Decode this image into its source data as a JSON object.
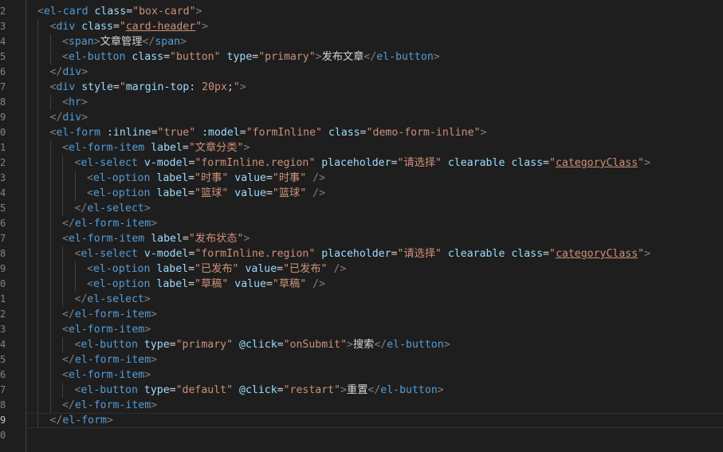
{
  "editor": {
    "language": "vue-html",
    "theme_colors": {
      "background": "#1e1e1e",
      "bracket": "#808080",
      "tag": "#569cd6",
      "attribute": "#9cdcfe",
      "string": "#ce9178",
      "text": "#d4d4d4",
      "line_number": "#858585"
    },
    "active_line_number": "9",
    "line_numbers": [
      "2",
      "3",
      "4",
      "5",
      "6",
      "7",
      "8",
      "9",
      "0",
      "1",
      "2",
      "3",
      "4",
      "5",
      "6",
      "7",
      "8",
      "9",
      "0",
      "1",
      "2",
      "3",
      "4",
      "5",
      "6",
      "7",
      "8",
      "9",
      "0"
    ],
    "lines": [
      {
        "indent": 0,
        "tokens": [
          [
            "brk",
            "<"
          ],
          [
            "tag",
            "el-card"
          ],
          [
            "txt",
            " "
          ],
          [
            "attr",
            "class"
          ],
          [
            "eq",
            "="
          ],
          [
            "str",
            "\"box-card\""
          ],
          [
            "brk",
            ">"
          ]
        ]
      },
      {
        "indent": 1,
        "tokens": [
          [
            "brk",
            "<"
          ],
          [
            "tag",
            "div"
          ],
          [
            "txt",
            " "
          ],
          [
            "attr",
            "class"
          ],
          [
            "eq",
            "="
          ],
          [
            "str",
            "\""
          ],
          [
            "strul",
            "card-header"
          ],
          [
            "str",
            "\""
          ],
          [
            "brk",
            ">"
          ]
        ]
      },
      {
        "indent": 2,
        "tokens": [
          [
            "brk",
            "<"
          ],
          [
            "tag",
            "span"
          ],
          [
            "brk",
            ">"
          ],
          [
            "txt",
            "文章管理"
          ],
          [
            "brk",
            "</"
          ],
          [
            "tag",
            "span"
          ],
          [
            "brk",
            ">"
          ]
        ]
      },
      {
        "indent": 2,
        "tokens": [
          [
            "brk",
            "<"
          ],
          [
            "tag",
            "el-button"
          ],
          [
            "txt",
            " "
          ],
          [
            "attr",
            "class"
          ],
          [
            "eq",
            "="
          ],
          [
            "str",
            "\"button\""
          ],
          [
            "txt",
            " "
          ],
          [
            "attr",
            "type"
          ],
          [
            "eq",
            "="
          ],
          [
            "str",
            "\"primary\""
          ],
          [
            "brk",
            ">"
          ],
          [
            "txt",
            "发布文章"
          ],
          [
            "brk",
            "</"
          ],
          [
            "tag",
            "el-button"
          ],
          [
            "brk",
            ">"
          ]
        ]
      },
      {
        "indent": 1,
        "tokens": [
          [
            "brk",
            "</"
          ],
          [
            "tag",
            "div"
          ],
          [
            "brk",
            ">"
          ]
        ]
      },
      {
        "indent": 1,
        "tokens": [
          [
            "brk",
            "<"
          ],
          [
            "tag",
            "div"
          ],
          [
            "txt",
            " "
          ],
          [
            "attr",
            "style"
          ],
          [
            "eq",
            "="
          ],
          [
            "str",
            "\""
          ],
          [
            "attr",
            "margin-top"
          ],
          [
            "txt",
            ": "
          ],
          [
            "str",
            "20px"
          ],
          [
            "txt",
            ";"
          ],
          [
            "str",
            "\""
          ],
          [
            "brk",
            ">"
          ]
        ]
      },
      {
        "indent": 2,
        "tokens": [
          [
            "brk",
            "<"
          ],
          [
            "tag",
            "hr"
          ],
          [
            "brk",
            ">"
          ]
        ]
      },
      {
        "indent": 1,
        "tokens": [
          [
            "brk",
            "</"
          ],
          [
            "tag",
            "div"
          ],
          [
            "brk",
            ">"
          ]
        ]
      },
      {
        "indent": 1,
        "tokens": [
          [
            "brk",
            "<"
          ],
          [
            "tag",
            "el-form"
          ],
          [
            "txt",
            " "
          ],
          [
            "attr",
            ":inline"
          ],
          [
            "eq",
            "="
          ],
          [
            "str",
            "\"true\""
          ],
          [
            "txt",
            " "
          ],
          [
            "attr",
            ":model"
          ],
          [
            "eq",
            "="
          ],
          [
            "str",
            "\"formInline\""
          ],
          [
            "txt",
            " "
          ],
          [
            "attr",
            "class"
          ],
          [
            "eq",
            "="
          ],
          [
            "str",
            "\"demo-form-inline\""
          ],
          [
            "brk",
            ">"
          ]
        ]
      },
      {
        "indent": 2,
        "tokens": [
          [
            "brk",
            "<"
          ],
          [
            "tag",
            "el-form-item"
          ],
          [
            "txt",
            " "
          ],
          [
            "attr",
            "label"
          ],
          [
            "eq",
            "="
          ],
          [
            "str",
            "\"文章分类\""
          ],
          [
            "brk",
            ">"
          ]
        ]
      },
      {
        "indent": 3,
        "tokens": [
          [
            "brk",
            "<"
          ],
          [
            "tag",
            "el-select"
          ],
          [
            "txt",
            " "
          ],
          [
            "attr",
            "v-model"
          ],
          [
            "eq",
            "="
          ],
          [
            "str",
            "\"formInline.region\""
          ],
          [
            "txt",
            " "
          ],
          [
            "attr",
            "placeholder"
          ],
          [
            "eq",
            "="
          ],
          [
            "str",
            "\"请选择\""
          ],
          [
            "txt",
            " "
          ],
          [
            "attr",
            "clearable"
          ],
          [
            "txt",
            " "
          ],
          [
            "attr",
            "class"
          ],
          [
            "eq",
            "="
          ],
          [
            "str",
            "\""
          ],
          [
            "strul",
            "categoryClass"
          ],
          [
            "str",
            "\""
          ],
          [
            "brk",
            ">"
          ]
        ]
      },
      {
        "indent": 4,
        "tokens": [
          [
            "brk",
            "<"
          ],
          [
            "tag",
            "el-option"
          ],
          [
            "txt",
            " "
          ],
          [
            "attr",
            "label"
          ],
          [
            "eq",
            "="
          ],
          [
            "str",
            "\"时事\""
          ],
          [
            "txt",
            " "
          ],
          [
            "attr",
            "value"
          ],
          [
            "eq",
            "="
          ],
          [
            "str",
            "\"时事\""
          ],
          [
            "txt",
            " "
          ],
          [
            "brk",
            "/>"
          ]
        ]
      },
      {
        "indent": 4,
        "tokens": [
          [
            "brk",
            "<"
          ],
          [
            "tag",
            "el-option"
          ],
          [
            "txt",
            " "
          ],
          [
            "attr",
            "label"
          ],
          [
            "eq",
            "="
          ],
          [
            "str",
            "\"篮球\""
          ],
          [
            "txt",
            " "
          ],
          [
            "attr",
            "value"
          ],
          [
            "eq",
            "="
          ],
          [
            "str",
            "\"篮球\""
          ],
          [
            "txt",
            " "
          ],
          [
            "brk",
            "/>"
          ]
        ]
      },
      {
        "indent": 3,
        "tokens": [
          [
            "brk",
            "</"
          ],
          [
            "tag",
            "el-select"
          ],
          [
            "brk",
            ">"
          ]
        ]
      },
      {
        "indent": 2,
        "tokens": [
          [
            "brk",
            "</"
          ],
          [
            "tag",
            "el-form-item"
          ],
          [
            "brk",
            ">"
          ]
        ]
      },
      {
        "indent": 2,
        "tokens": [
          [
            "brk",
            "<"
          ],
          [
            "tag",
            "el-form-item"
          ],
          [
            "txt",
            " "
          ],
          [
            "attr",
            "label"
          ],
          [
            "eq",
            "="
          ],
          [
            "str",
            "\"发布状态\""
          ],
          [
            "brk",
            ">"
          ]
        ]
      },
      {
        "indent": 3,
        "tokens": [
          [
            "brk",
            "<"
          ],
          [
            "tag",
            "el-select"
          ],
          [
            "txt",
            " "
          ],
          [
            "attr",
            "v-model"
          ],
          [
            "eq",
            "="
          ],
          [
            "str",
            "\"formInline.region\""
          ],
          [
            "txt",
            " "
          ],
          [
            "attr",
            "placeholder"
          ],
          [
            "eq",
            "="
          ],
          [
            "str",
            "\"请选择\""
          ],
          [
            "txt",
            " "
          ],
          [
            "attr",
            "clearable"
          ],
          [
            "txt",
            " "
          ],
          [
            "attr",
            "class"
          ],
          [
            "eq",
            "="
          ],
          [
            "str",
            "\""
          ],
          [
            "strul",
            "categoryClass"
          ],
          [
            "str",
            "\""
          ],
          [
            "brk",
            ">"
          ]
        ]
      },
      {
        "indent": 4,
        "tokens": [
          [
            "brk",
            "<"
          ],
          [
            "tag",
            "el-option"
          ],
          [
            "txt",
            " "
          ],
          [
            "attr",
            "label"
          ],
          [
            "eq",
            "="
          ],
          [
            "str",
            "\"已发布\""
          ],
          [
            "txt",
            " "
          ],
          [
            "attr",
            "value"
          ],
          [
            "eq",
            "="
          ],
          [
            "str",
            "\"已发布\""
          ],
          [
            "txt",
            " "
          ],
          [
            "brk",
            "/>"
          ]
        ]
      },
      {
        "indent": 4,
        "tokens": [
          [
            "brk",
            "<"
          ],
          [
            "tag",
            "el-option"
          ],
          [
            "txt",
            " "
          ],
          [
            "attr",
            "label"
          ],
          [
            "eq",
            "="
          ],
          [
            "str",
            "\"草稿\""
          ],
          [
            "txt",
            " "
          ],
          [
            "attr",
            "value"
          ],
          [
            "eq",
            "="
          ],
          [
            "str",
            "\"草稿\""
          ],
          [
            "txt",
            " "
          ],
          [
            "brk",
            "/>"
          ]
        ]
      },
      {
        "indent": 3,
        "tokens": [
          [
            "brk",
            "</"
          ],
          [
            "tag",
            "el-select"
          ],
          [
            "brk",
            ">"
          ]
        ]
      },
      {
        "indent": 2,
        "tokens": [
          [
            "brk",
            "</"
          ],
          [
            "tag",
            "el-form-item"
          ],
          [
            "brk",
            ">"
          ]
        ]
      },
      {
        "indent": 2,
        "tokens": [
          [
            "brk",
            "<"
          ],
          [
            "tag",
            "el-form-item"
          ],
          [
            "brk",
            ">"
          ]
        ]
      },
      {
        "indent": 3,
        "tokens": [
          [
            "brk",
            "<"
          ],
          [
            "tag",
            "el-button"
          ],
          [
            "txt",
            " "
          ],
          [
            "attr",
            "type"
          ],
          [
            "eq",
            "="
          ],
          [
            "str",
            "\"primary\""
          ],
          [
            "txt",
            " "
          ],
          [
            "attr",
            "@click"
          ],
          [
            "eq",
            "="
          ],
          [
            "str",
            "\"onSubmit\""
          ],
          [
            "brk",
            ">"
          ],
          [
            "txt",
            "搜索"
          ],
          [
            "brk",
            "</"
          ],
          [
            "tag",
            "el-button"
          ],
          [
            "brk",
            ">"
          ]
        ]
      },
      {
        "indent": 2,
        "tokens": [
          [
            "brk",
            "</"
          ],
          [
            "tag",
            "el-form-item"
          ],
          [
            "brk",
            ">"
          ]
        ]
      },
      {
        "indent": 2,
        "tokens": [
          [
            "brk",
            "<"
          ],
          [
            "tag",
            "el-form-item"
          ],
          [
            "brk",
            ">"
          ]
        ]
      },
      {
        "indent": 3,
        "tokens": [
          [
            "brk",
            "<"
          ],
          [
            "tag",
            "el-button"
          ],
          [
            "txt",
            " "
          ],
          [
            "attr",
            "type"
          ],
          [
            "eq",
            "="
          ],
          [
            "str",
            "\"default\""
          ],
          [
            "txt",
            " "
          ],
          [
            "attr",
            "@click"
          ],
          [
            "eq",
            "="
          ],
          [
            "str",
            "\"restart\""
          ],
          [
            "brk",
            ">"
          ],
          [
            "txt",
            "重置"
          ],
          [
            "brk",
            "</"
          ],
          [
            "tag",
            "el-button"
          ],
          [
            "brk",
            ">"
          ]
        ]
      },
      {
        "indent": 2,
        "tokens": [
          [
            "brk",
            "</"
          ],
          [
            "tag",
            "el-form-item"
          ],
          [
            "brk",
            ">"
          ]
        ]
      },
      {
        "indent": 1,
        "tokens": [
          [
            "brk",
            "</"
          ],
          [
            "tag",
            "el-form"
          ],
          [
            "brk",
            ">"
          ]
        ]
      },
      {
        "indent": 0,
        "tokens": []
      }
    ]
  }
}
